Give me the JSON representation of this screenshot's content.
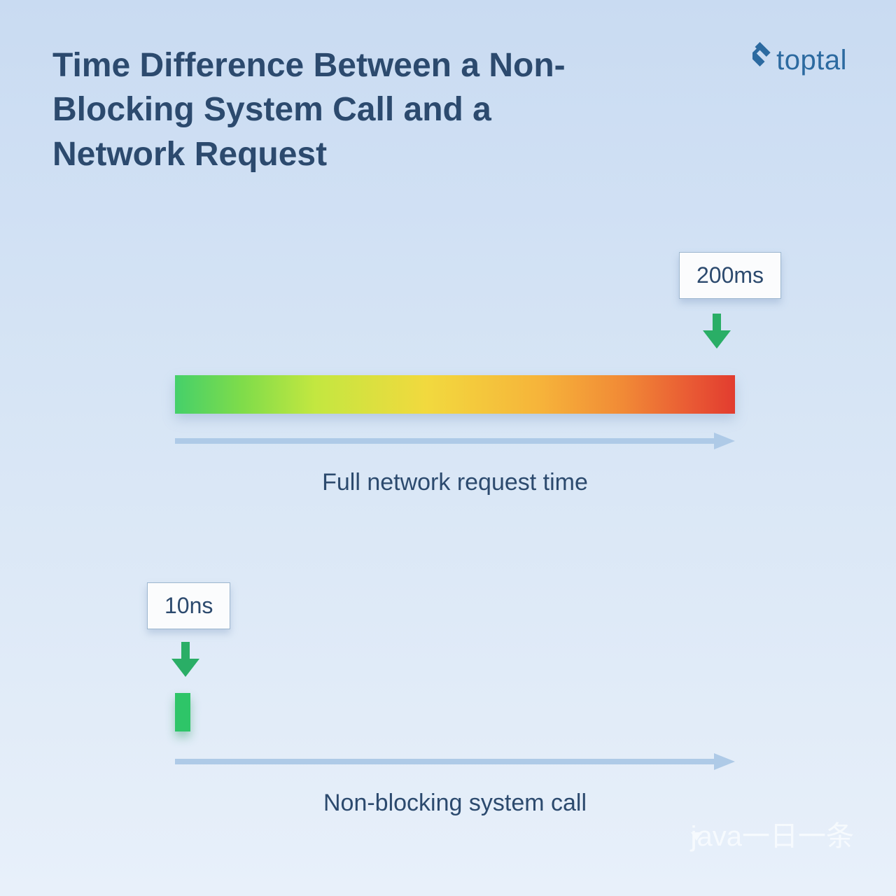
{
  "title": "Time Difference Between a Non-Blocking System Call and a Network Request",
  "brand": "toptal",
  "network": {
    "badge": "200ms",
    "caption": "Full network request time"
  },
  "syscall": {
    "badge": "10ns",
    "caption": "Non-blocking system call"
  },
  "watermark": "java一日一条",
  "colors": {
    "text": "#2c4a6e",
    "axis": "#aecae7",
    "marker": "#2aae66",
    "brand": "#2c6aa0"
  }
}
